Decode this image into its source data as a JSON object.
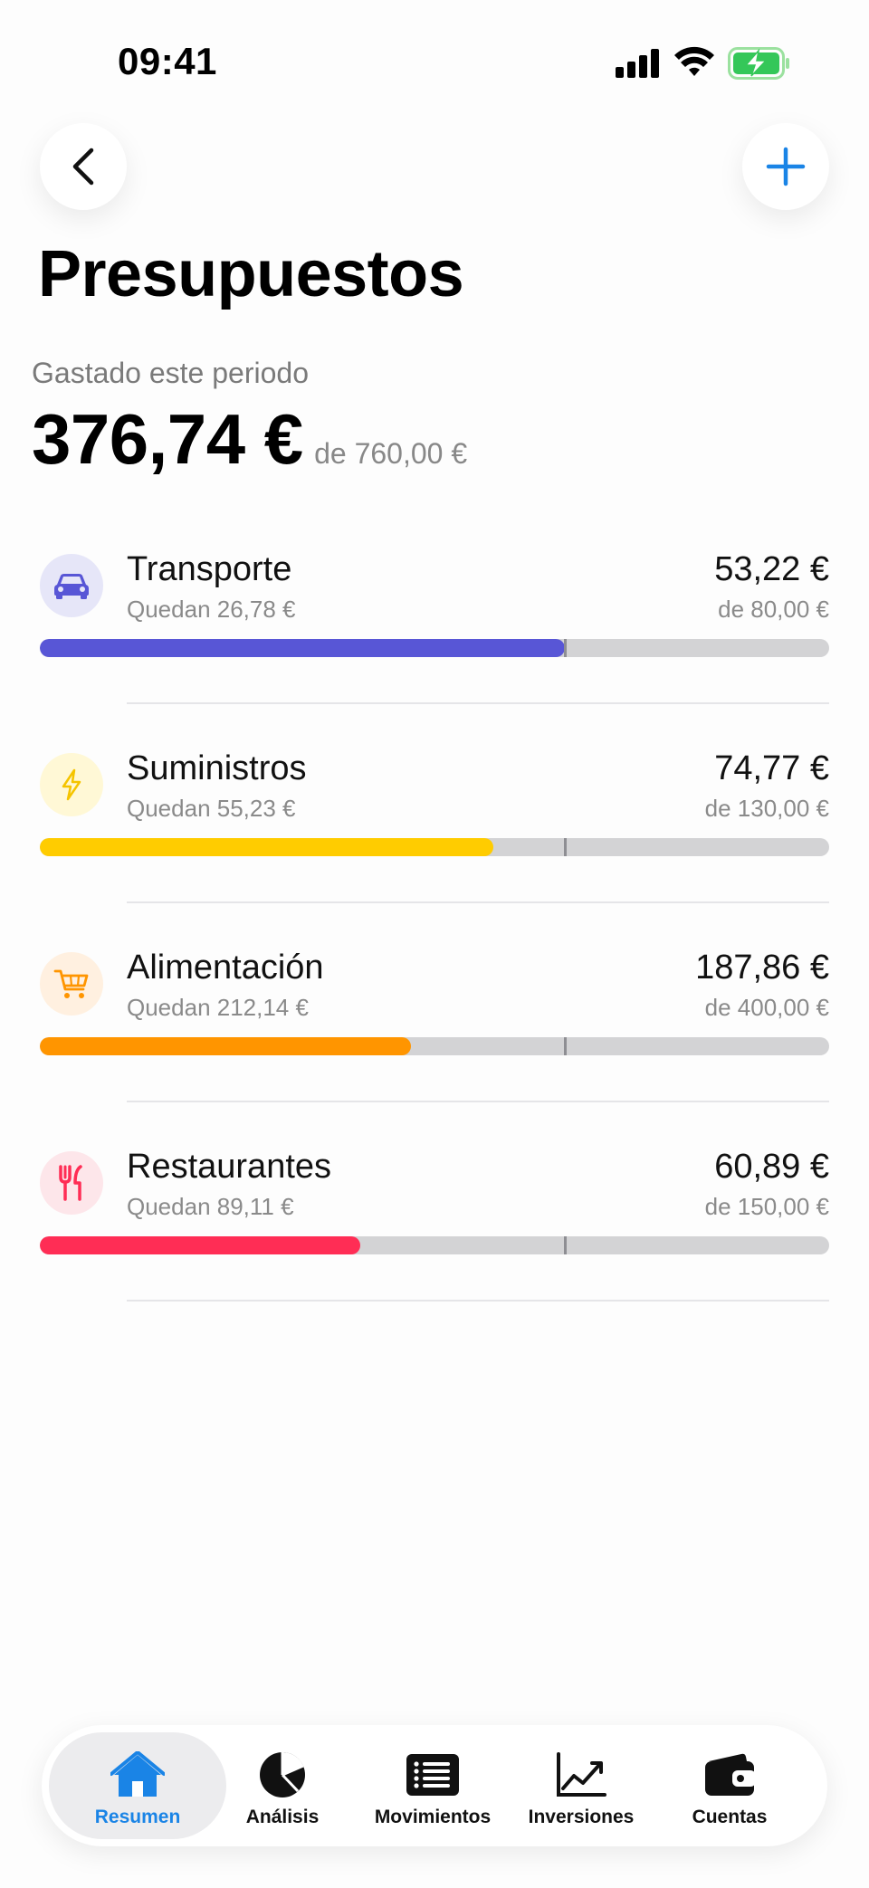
{
  "status_bar": {
    "time": "09:41"
  },
  "header": {
    "title": "Presupuestos"
  },
  "summary": {
    "label": "Gastado este periodo",
    "spent": "376,74 €",
    "total": "de 760,00 €"
  },
  "budgets": [
    {
      "name": "Transporte",
      "remaining": "Quedan 26,78 €",
      "spent": "53,22 €",
      "limit": "de 80,00 €",
      "progress": 0.665,
      "color": "#5856d6",
      "icon": "car-icon"
    },
    {
      "name": "Suministros",
      "remaining": "Quedan 55,23 €",
      "spent": "74,77 €",
      "limit": "de 130,00 €",
      "progress": 0.575,
      "color": "#ffcc00",
      "icon": "bolt-icon"
    },
    {
      "name": "Alimentación",
      "remaining": "Quedan 212,14 €",
      "spent": "187,86 €",
      "limit": "de 400,00 €",
      "progress": 0.47,
      "color": "#ff9500",
      "icon": "cart-icon"
    },
    {
      "name": "Restaurantes",
      "remaining": "Quedan 89,11 €",
      "spent": "60,89 €",
      "limit": "de 150,00 €",
      "progress": 0.406,
      "color": "#ff2d55",
      "icon": "fork-knife-icon"
    }
  ],
  "tab_bar": {
    "tabs": [
      {
        "label": "Resumen",
        "icon": "house-icon",
        "active": true
      },
      {
        "label": "Análisis",
        "icon": "pie-chart-icon",
        "active": false
      },
      {
        "label": "Movimientos",
        "icon": "list-icon",
        "active": false
      },
      {
        "label": "Inversiones",
        "icon": "chart-line-icon",
        "active": false
      },
      {
        "label": "Cuentas",
        "icon": "wallet-icon",
        "active": false
      }
    ]
  },
  "colors": {
    "accent": "#1a84e6",
    "transporte": "#5856d6",
    "suministros": "#ffcc00",
    "alimentacion": "#ff9500",
    "restaurantes": "#ff2d55"
  }
}
